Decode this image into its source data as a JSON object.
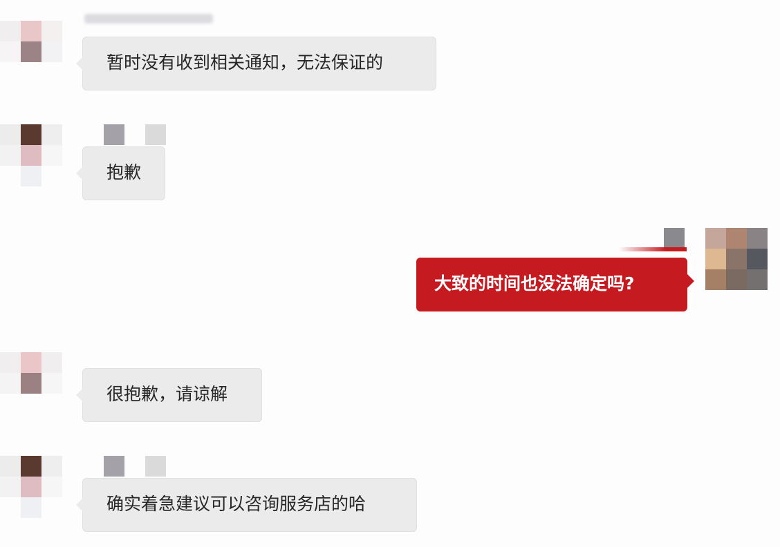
{
  "colors": {
    "background": "#fdfdfe",
    "incoming_bubble": "#ebebeb",
    "incoming_text": "#262626",
    "outgoing_bubble": "#c41a20",
    "outgoing_text": "#ffffff"
  },
  "messages": [
    {
      "side": "incoming",
      "text": "暂时没有收到相关通知，无法保证的"
    },
    {
      "side": "incoming",
      "text": "抱歉"
    },
    {
      "side": "outgoing",
      "text": "大致的时间也没法确定吗?"
    },
    {
      "side": "incoming",
      "text": "很抱歉，请谅解"
    },
    {
      "side": "incoming",
      "text": "确实着急建议可以咨询服务店的哈"
    }
  ],
  "icons": {
    "avatar": "pixelated-avatar-icon"
  }
}
